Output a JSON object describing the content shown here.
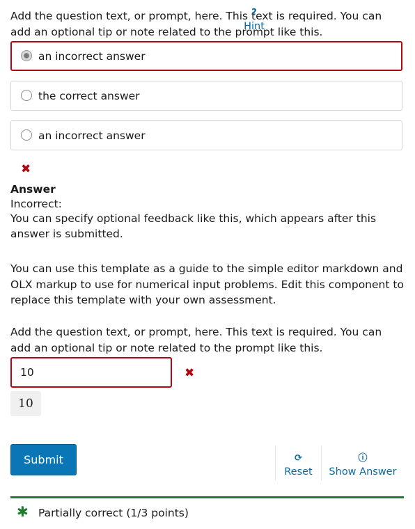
{
  "problem1": {
    "prompt": "Add the question text, or prompt, here. This text is required. You can add an optional tip or note related to the prompt like this.",
    "options": [
      {
        "label": "an incorrect answer",
        "selected": true
      },
      {
        "label": "the correct answer",
        "selected": false
      },
      {
        "label": "an incorrect answer",
        "selected": false
      }
    ],
    "result_icon": "x-mark-icon",
    "answer_heading": "Answer",
    "answer_status": "Incorrect:",
    "feedback": "You can specify optional feedback like this, which appears after this answer is submitted."
  },
  "template_note": "You can use this template as a guide to the simple editor markdown and OLX markup to use for numerical input problems. Edit this component to replace this template with your own assessment.",
  "problem2": {
    "prompt": "Add the question text, or prompt, here. This text is required. You can add an optional tip or note related to the prompt like this.",
    "input_value": "10",
    "preview_value": "10",
    "result_icon": "x-mark-icon"
  },
  "actions": {
    "submit_label": "Submit",
    "hint_label": "Hint",
    "reset_label": "Reset",
    "show_answer_label": "Show Answer"
  },
  "status": {
    "text": "Partially correct (1/3 points)"
  },
  "colors": {
    "incorrect": "#b20610",
    "correct": "#1e7a2d",
    "primary": "#0b76b6",
    "link": "#0b6aa2"
  }
}
